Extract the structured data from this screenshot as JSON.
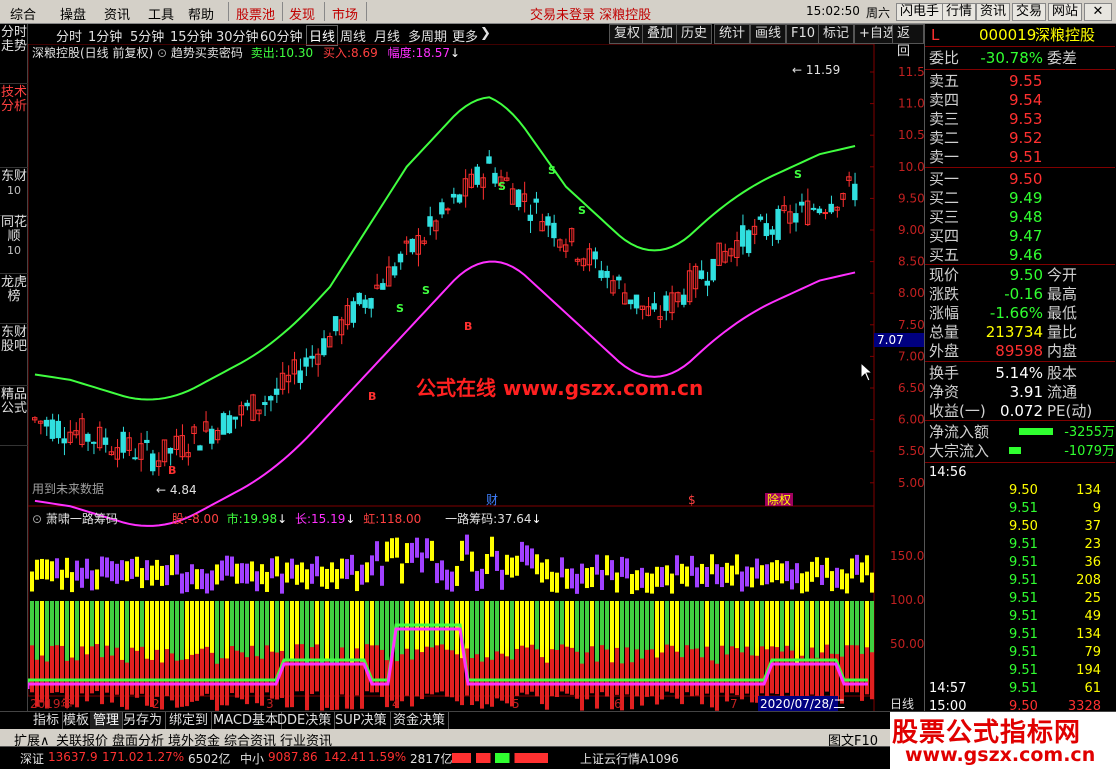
{
  "menubar": {
    "items": [
      "综合",
      "操盘",
      "资讯",
      "工具",
      "帮助"
    ],
    "highlight_items": [
      "股票池",
      "发现",
      "市场"
    ],
    "status": "交易未登录  深粮控股",
    "time": "15:02:50",
    "weekday": "周六",
    "right_buttons": [
      "闪电手",
      "行情",
      "资讯",
      "交易",
      "网站"
    ]
  },
  "left_tabs": [
    {
      "label": "分时走势",
      "num": ""
    },
    {
      "label": "技术分析",
      "num": ""
    },
    {
      "label": "东财",
      "num": "10"
    },
    {
      "label": "同花顺",
      "num": "10"
    },
    {
      "label": "龙虎榜",
      "num": ""
    },
    {
      "label": "东财股吧",
      "num": ""
    },
    {
      "label": "精品公式",
      "num": ""
    }
  ],
  "periods": [
    "分时",
    "1分钟",
    "5分钟",
    "15分钟",
    "30分钟",
    "60分钟",
    "日线",
    "周线",
    "月线",
    "多周期",
    "更多"
  ],
  "tools": [
    "复权",
    "叠加",
    "历史",
    "统计",
    "画线",
    "F10",
    "标记",
    "+自选",
    "返回"
  ],
  "main_indicator": {
    "title": "深粮控股(日线 前复权)",
    "formula": "趋势买卖密码",
    "sell_label": "卖出:",
    "sell_value": "10.30",
    "buy_label": "买入:",
    "buy_value": "8.69",
    "range_label": "幅度:",
    "range_value": "18.57"
  },
  "price_axis": [
    "11.50",
    "11.00",
    "10.50",
    "10.00",
    "9.50",
    "9.00",
    "8.50",
    "8.00",
    "7.50",
    "7.00",
    "6.50",
    "6.00",
    "5.50",
    "5.00"
  ],
  "price_marker": "7.07",
  "high_label": "11.59",
  "low_label": "4.84",
  "future_data_note": "用到未来数据",
  "event_markers": [
    "财",
    "$",
    "除权"
  ],
  "watermark_chart": "公式在线  www.gszx.com.cn",
  "sub_indicator": {
    "title": "萧啸一路筹码",
    "a_label": "股:",
    "a_value": "-8.00",
    "b_label": "市:",
    "b_value": "19.98",
    "c_label": "长:",
    "c_value": "15.19",
    "d_label": "虹:",
    "d_value": "118.00",
    "e_label": "一路筹码:",
    "e_value": "37.64"
  },
  "sub_axis": [
    "150.0",
    "100.0",
    "50.00"
  ],
  "date_axis": [
    "2019年",
    "2",
    "3",
    "4",
    "5",
    "6",
    "7"
  ],
  "cursor_date": "2020/07/28/二",
  "axis_mode": "日线",
  "quote": {
    "code_prefix": "L",
    "code": "000019",
    "name": "深粮控股",
    "weibi_label": "委比",
    "weibi_value": "-30.78%",
    "weicha_label": "委差",
    "asks": [
      {
        "label": "卖五",
        "price": "9.55"
      },
      {
        "label": "卖四",
        "price": "9.54"
      },
      {
        "label": "卖三",
        "price": "9.53"
      },
      {
        "label": "卖二",
        "price": "9.52"
      },
      {
        "label": "卖一",
        "price": "9.51"
      }
    ],
    "bids": [
      {
        "label": "买一",
        "price": "9.50"
      },
      {
        "label": "买二",
        "price": "9.49"
      },
      {
        "label": "买三",
        "price": "9.48"
      },
      {
        "label": "买四",
        "price": "9.47"
      },
      {
        "label": "买五",
        "price": "9.46"
      }
    ],
    "stats": [
      {
        "l1": "现价",
        "v1": "9.50",
        "l2": "今开"
      },
      {
        "l1": "涨跌",
        "v1": "-0.16",
        "l2": "最高"
      },
      {
        "l1": "涨幅",
        "v1": "-1.66%",
        "l2": "最低"
      },
      {
        "l1": "总量",
        "v1": "213734",
        "l2": "量比"
      },
      {
        "l1": "外盘",
        "v1": "89598",
        "l2": "内盘"
      }
    ],
    "stats2": [
      {
        "l1": "换手",
        "v1": "5.14%",
        "l2": "股本"
      },
      {
        "l1": "净资",
        "v1": "3.91",
        "l2": "流通"
      },
      {
        "l1": "收益(一)",
        "v1": "0.072",
        "l2": "PE(动)"
      }
    ],
    "flows": [
      {
        "label": "净流入额",
        "value": "-3255万"
      },
      {
        "label": "大宗流入",
        "value": "-1079万"
      }
    ],
    "ticks_header_1": "14:56",
    "ticks": [
      {
        "price": "9.50",
        "vol": "134"
      },
      {
        "price": "9.51",
        "vol": "9"
      },
      {
        "price": "9.50",
        "vol": "37"
      },
      {
        "price": "9.51",
        "vol": "23"
      },
      {
        "price": "9.51",
        "vol": "36"
      },
      {
        "price": "9.51",
        "vol": "208"
      },
      {
        "price": "9.51",
        "vol": "25"
      },
      {
        "price": "9.51",
        "vol": "49"
      },
      {
        "price": "9.51",
        "vol": "134"
      },
      {
        "price": "9.51",
        "vol": "79"
      },
      {
        "price": "9.51",
        "vol": "194"
      }
    ],
    "ticks_header_2": "14:57",
    "tick_last": {
      "price": "9.51",
      "vol": "61"
    },
    "tick_final": {
      "time": "15:00",
      "price": "9.50",
      "vol": "3328"
    }
  },
  "bottom_tabs": [
    "指标",
    "模板",
    "管理",
    "另存为",
    "绑定到",
    "MACD基本",
    "DDE决策",
    "SUP决策",
    "资金决策"
  ],
  "bottom_tabs_selected": "管理",
  "bottom_bar2": [
    "扩展∧",
    "关联报价",
    "盘面分析",
    "境外资金",
    "综合资讯",
    "行业资讯"
  ],
  "bottom_bar2_right": "图文F10",
  "index_bar": {
    "sz_name": "深证",
    "sz_value": "13637.9",
    "sz_change": "171.02",
    "sz_pct": "1.27%",
    "sz_amount": "6502亿",
    "zx_name": "中小",
    "zx_value": "9087.86",
    "zx_change": "142.41",
    "zx_pct": "1.59%",
    "zx_amount": "2817亿",
    "ticker": "上证云行情A1096"
  },
  "site_watermark": {
    "title": "股票公式指标网",
    "url": "www.gszx.com.cn"
  }
}
